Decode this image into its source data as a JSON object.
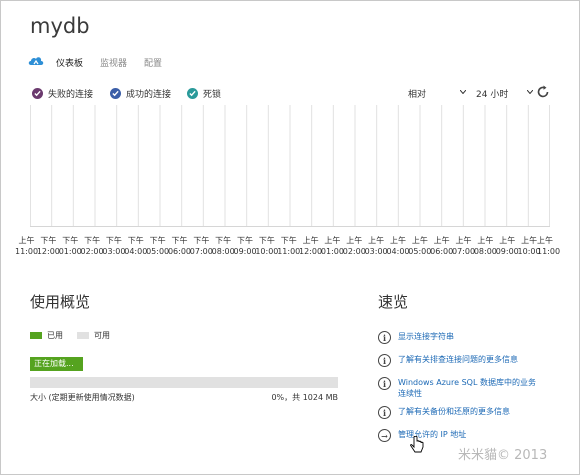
{
  "header": {
    "title": "mydb"
  },
  "tabs": [
    {
      "label": "仪表板",
      "active": true
    },
    {
      "label": "监视器",
      "active": false
    },
    {
      "label": "配置",
      "active": false
    }
  ],
  "chart_legend": [
    {
      "label": "失败的连接",
      "color": "#6b3a6e"
    },
    {
      "label": "成功的连接",
      "color": "#3b5ea8"
    },
    {
      "label": "死锁",
      "color": "#2a9a9a"
    }
  ],
  "filters": {
    "mode": "相对",
    "range": "24 小时"
  },
  "chart_data": {
    "type": "line",
    "series": [
      {
        "name": "失败的连接",
        "values": []
      },
      {
        "name": "成功的连接",
        "values": []
      },
      {
        "name": "死锁",
        "values": []
      }
    ],
    "x_ticks": [
      [
        "上午",
        "11:00"
      ],
      [
        "下午",
        "12:00"
      ],
      [
        "下午",
        "01:00"
      ],
      [
        "下午",
        "02:00"
      ],
      [
        "下午",
        "03:00"
      ],
      [
        "下午",
        "04:00"
      ],
      [
        "下午",
        "05:00"
      ],
      [
        "下午",
        "06:00"
      ],
      [
        "下午",
        "07:00"
      ],
      [
        "下午",
        "08:00"
      ],
      [
        "下午",
        "09:00"
      ],
      [
        "下午",
        "10:00"
      ],
      [
        "下午",
        "11:00"
      ],
      [
        "上午",
        "12:00"
      ],
      [
        "上午",
        "01:00"
      ],
      [
        "上午",
        "02:00"
      ],
      [
        "上午",
        "03:00"
      ],
      [
        "上午",
        "04:00"
      ],
      [
        "上午",
        "05:00"
      ],
      [
        "上午",
        "06:00"
      ],
      [
        "上午",
        "07:00"
      ],
      [
        "上午",
        "08:00"
      ],
      [
        "上午",
        "09:00"
      ],
      [
        "上午",
        "10:00"
      ],
      [
        "上午",
        "11:00"
      ]
    ],
    "grid": true
  },
  "usage": {
    "title": "使用概览",
    "used_label": "已用",
    "available_label": "可用",
    "used_color": "#55a31f",
    "available_color": "#e1e1e1",
    "loading_label": "正在加载...",
    "size_label": "大小 (定期更新使用情况数据)",
    "size_value": "0%，共 1024 MB",
    "used_fraction": 0
  },
  "quick": {
    "title": "速览",
    "links": [
      {
        "icon": "info-icon",
        "lines": [
          "显示连接字符串"
        ]
      },
      {
        "icon": "info-icon",
        "lines": [
          "了解有关排查连接问题的更多信息"
        ]
      },
      {
        "icon": "info-icon",
        "lines": [
          "Windows Azure SQL 数据库中的业务",
          "连续性"
        ]
      },
      {
        "icon": "info-icon",
        "lines": [
          "了解有关备份和还原的更多信息"
        ]
      },
      {
        "icon": "arrow-right-icon",
        "lines": [
          "管理允许的 IP 地址"
        ]
      }
    ]
  },
  "watermark": "米米貓© 2013"
}
